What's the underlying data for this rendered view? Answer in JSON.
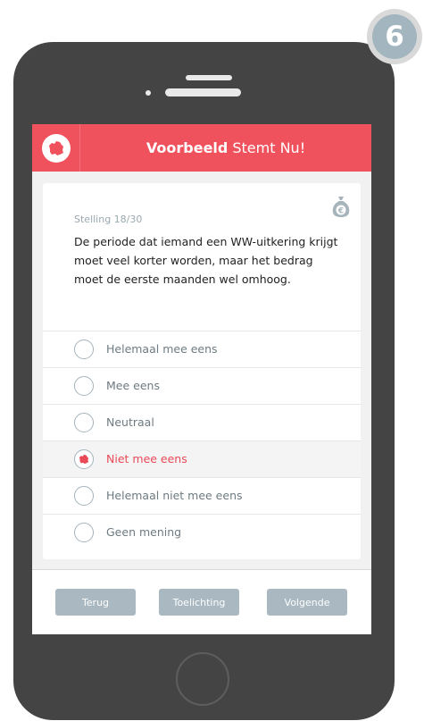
{
  "step_badge": {
    "number": "6"
  },
  "app": {
    "title_bold": "Voorbeeld",
    "title_rest": "Stemt Nu!",
    "accent_color": "#ef525d",
    "logo_icon": "party-logo-icon"
  },
  "card": {
    "bag_icon": "euro-money-bag-icon",
    "stelling_label": "Stelling 18/30",
    "question": "De periode dat iemand een WW-uitkering krijgt moet veel korter worden, maar het bedrag moet de eerste maanden wel omhoog."
  },
  "options": [
    {
      "label": "Helemaal mee eens",
      "selected": false
    },
    {
      "label": "Mee eens",
      "selected": false
    },
    {
      "label": "Neutraal",
      "selected": false
    },
    {
      "label": "Niet mee eens",
      "selected": true
    },
    {
      "label": "Helemaal niet mee eens",
      "selected": false
    },
    {
      "label": "Geen mening",
      "selected": false
    }
  ],
  "footer": {
    "back_label": "Terug",
    "info_label": "Toelichting",
    "next_label": "Volgende"
  }
}
